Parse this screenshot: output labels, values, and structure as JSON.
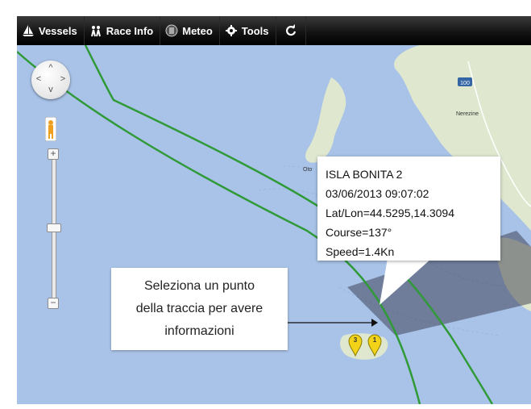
{
  "toolbar": {
    "items": [
      {
        "label": "Vessels",
        "icon": "sailboat-icon"
      },
      {
        "label": "Race Info",
        "icon": "crew-icon"
      },
      {
        "label": "Meteo",
        "icon": "meteo-icon"
      },
      {
        "label": "Tools",
        "icon": "gear-icon"
      }
    ],
    "refresh_icon": "refresh-icon"
  },
  "map": {
    "zoom_plus": "+",
    "zoom_minus": "−",
    "place_labels": [
      "Nerezine",
      "Oto"
    ],
    "road_badge": "100",
    "colors": {
      "sea": "#a9c3e8",
      "land": "#dfe8cf",
      "track": "#2f9a37"
    }
  },
  "popup": {
    "vessel": "ISLA BONITA 2",
    "datetime": "03/06/2013 09:07:02",
    "latlon": "Lat/Lon=44.5295,14.3094",
    "course": "Course=137°",
    "speed": "Speed=1.4Kn"
  },
  "annotation": {
    "line1": "Seleziona un punto",
    "line2": "della traccia per avere",
    "line3": "informazioni"
  },
  "markers": [
    {
      "label": "3"
    },
    {
      "label": "1"
    }
  ]
}
